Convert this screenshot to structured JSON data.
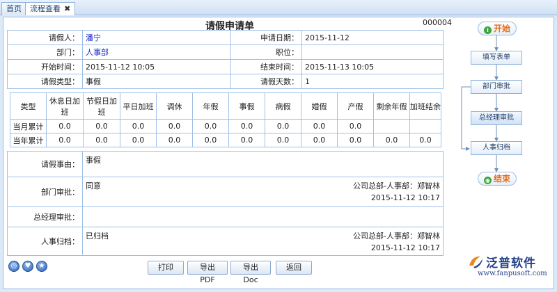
{
  "tabs": [
    {
      "label": "首页"
    },
    {
      "label": "流程查看",
      "close": "✖"
    }
  ],
  "form": {
    "title": "请假申请单",
    "doc_no": "000004",
    "fields": {
      "applicant_label": "请假人：",
      "applicant": "潘宁",
      "apply_date_label": "申请日期：",
      "apply_date": "2015-11-12",
      "dept_label": "部门：",
      "dept": "人事部",
      "position_label": "职位：",
      "position": "",
      "start_label": "开始时间：",
      "start": "2015-11-12 10:05",
      "end_label": "结束时间：",
      "end": "2015-11-13 10:05",
      "type_label": "请假类型：",
      "type": "事假",
      "days_label": "请假天数：",
      "days": "1"
    },
    "stats": {
      "headers": [
        "类型",
        "休息日加班",
        "节假日加班",
        "平日加班",
        "调休",
        "年假",
        "事假",
        "病假",
        "婚假",
        "产假",
        "剩余年假",
        "加班结余"
      ],
      "rows": [
        {
          "label": "当月累计",
          "values": [
            "0.0",
            "0.0",
            "0.0",
            "0.0",
            "0.0",
            "0.0",
            "0.0",
            "0.0",
            "0.0",
            "",
            ""
          ]
        },
        {
          "label": "当年累计",
          "values": [
            "0.0",
            "0.0",
            "0.0",
            "0.0",
            "0.0",
            "0.0",
            "0.0",
            "0.0",
            "0.0",
            "0.0",
            "0.0"
          ]
        }
      ]
    },
    "reason_label": "请假事由：",
    "reason": "事假",
    "dept_approval_label": "部门审批：",
    "dept_approval_text": "同意",
    "dept_approval_signer": "公司总部-人事部：郑智林",
    "dept_approval_time": "2015-11-12 10:17",
    "gm_approval_label": "总经理审批：",
    "gm_approval_text": "",
    "hr_archive_label": "人事归档：",
    "hr_archive_text": "已归档",
    "hr_archive_signer": "公司总部-人事部：郑智林",
    "hr_archive_time": "2015-11-12 10:17"
  },
  "buttons": {
    "print": "打印",
    "export_pdf": "导出PDF",
    "export_doc": "导出Doc",
    "back": "返回"
  },
  "flow": {
    "start": "开始",
    "steps": [
      "填写表单",
      "部门审批",
      "总经理审批",
      "人事归档"
    ],
    "end": "结束",
    "start_glyph": "i",
    "end_glyph": "◉"
  },
  "logo": {
    "name": "泛普软件",
    "url": "www.fanpusoft.com"
  },
  "colors": {
    "accent": "#e46c1a",
    "border": "#9fc0e6",
    "link": "#1a27c8"
  }
}
